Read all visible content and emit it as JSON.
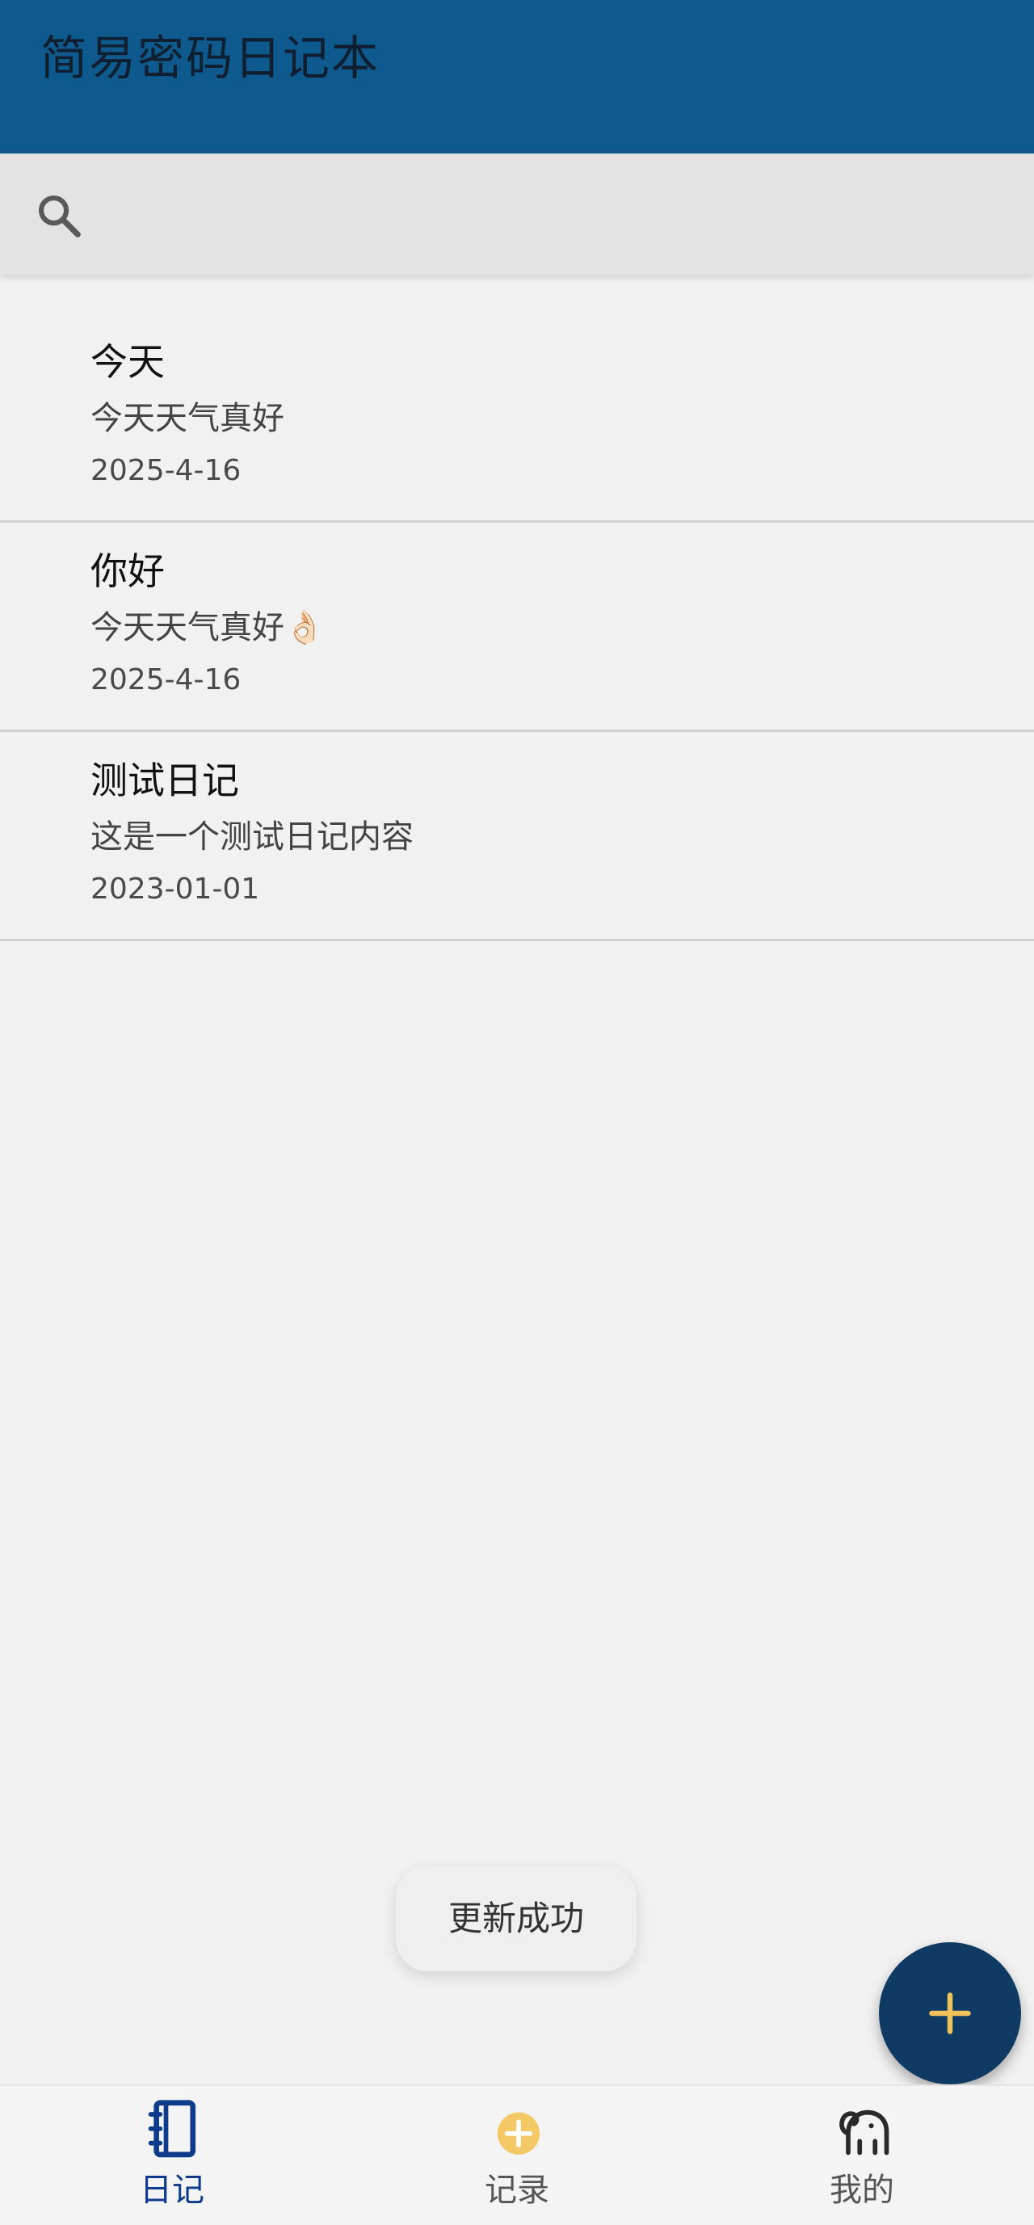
{
  "app": {
    "title": "简易密码日记本",
    "accent_color": "#0e5a8f",
    "fab_color": "#0e3a63"
  },
  "search": {
    "icon": "search-icon",
    "placeholder": "",
    "value": ""
  },
  "diary_items": [
    {
      "title": "今天",
      "content": "今天天气真好",
      "date": "2025-4-16"
    },
    {
      "title": "你好",
      "content": "今天天气真好👌🏻",
      "date": "2025-4-16"
    },
    {
      "title": "测试日记",
      "content": "这是一个测试日记内容",
      "date": "2023-01-01"
    }
  ],
  "toast": {
    "message": "更新成功"
  },
  "fab": {
    "icon": "plus-icon"
  },
  "bottom_nav": {
    "items": [
      {
        "label": "日记",
        "icon": "notebook-icon",
        "active": true
      },
      {
        "label": "记录",
        "icon": "add-circle-icon",
        "active": false
      },
      {
        "label": "我的",
        "icon": "elephant-icon",
        "active": false
      }
    ]
  }
}
